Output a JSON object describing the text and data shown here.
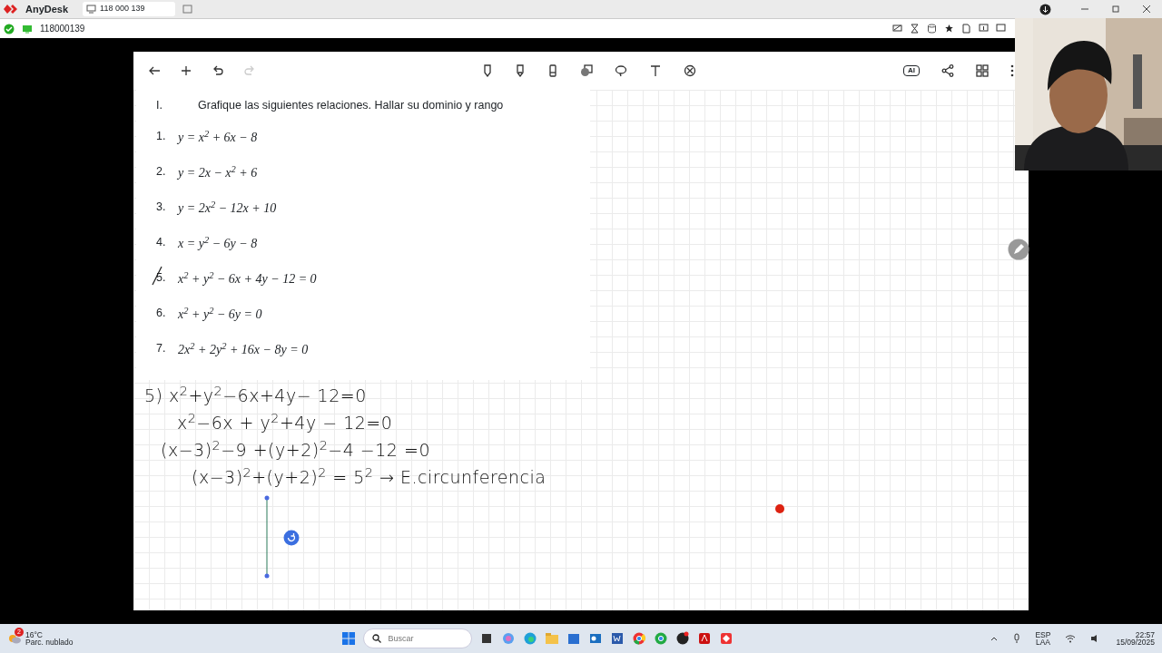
{
  "anydesk": {
    "app_name": "AnyDesk",
    "tab_label": "118 000 139",
    "address": "118000139"
  },
  "whiteboard": {
    "ai_label": "AI",
    "worksheet": {
      "heading_number": "I.",
      "heading": "Grafique las siguientes relaciones.  Hallar su dominio y rango",
      "problems": [
        {
          "number": "1.",
          "formula": "y = x$^{2}$ + 6x − 8",
          "crossed": false
        },
        {
          "number": "2.",
          "formula": "y = 2x − x$^{2}$ + 6",
          "crossed": false
        },
        {
          "number": "3.",
          "formula": "y = 2x$^{2}$ − 12x + 10",
          "crossed": false
        },
        {
          "number": "4.",
          "formula": "x = y$^{2}$ − 6y − 8",
          "crossed": false
        },
        {
          "number": "5.",
          "formula": "x$^{2}$ + y$^{2}$ − 6x + 4y − 12 = 0",
          "crossed": true
        },
        {
          "number": "6.",
          "formula": "x$^{2}$ + y$^{2}$ − 6y = 0",
          "crossed": false
        },
        {
          "number": "7.",
          "formula": "2x$^{2}$ + 2y$^{2}$ + 16x − 8y = 0",
          "crossed": false
        }
      ]
    },
    "handwritten_lines": [
      "5) x$^{2}$+y$^{2}$−6x+4y− 12=0",
      "x$^{2}$−6x + y$^{2}$+4y − 12=0",
      "(x−3)$^{2}$−9 +(y+2)$^{2}$−4 −12 =0",
      "(x−3)$^{2}$+(y+2)$^{2}$ = 5$^{2}$ → E.circunferencia"
    ]
  },
  "taskbar": {
    "weather_badge": "2",
    "temperature": "16°C",
    "weather": "Parc. nublado",
    "search_placeholder": "Buscar",
    "language": "ESP",
    "layout": "LAA",
    "time": "22:57",
    "date": "15/09/2025"
  }
}
